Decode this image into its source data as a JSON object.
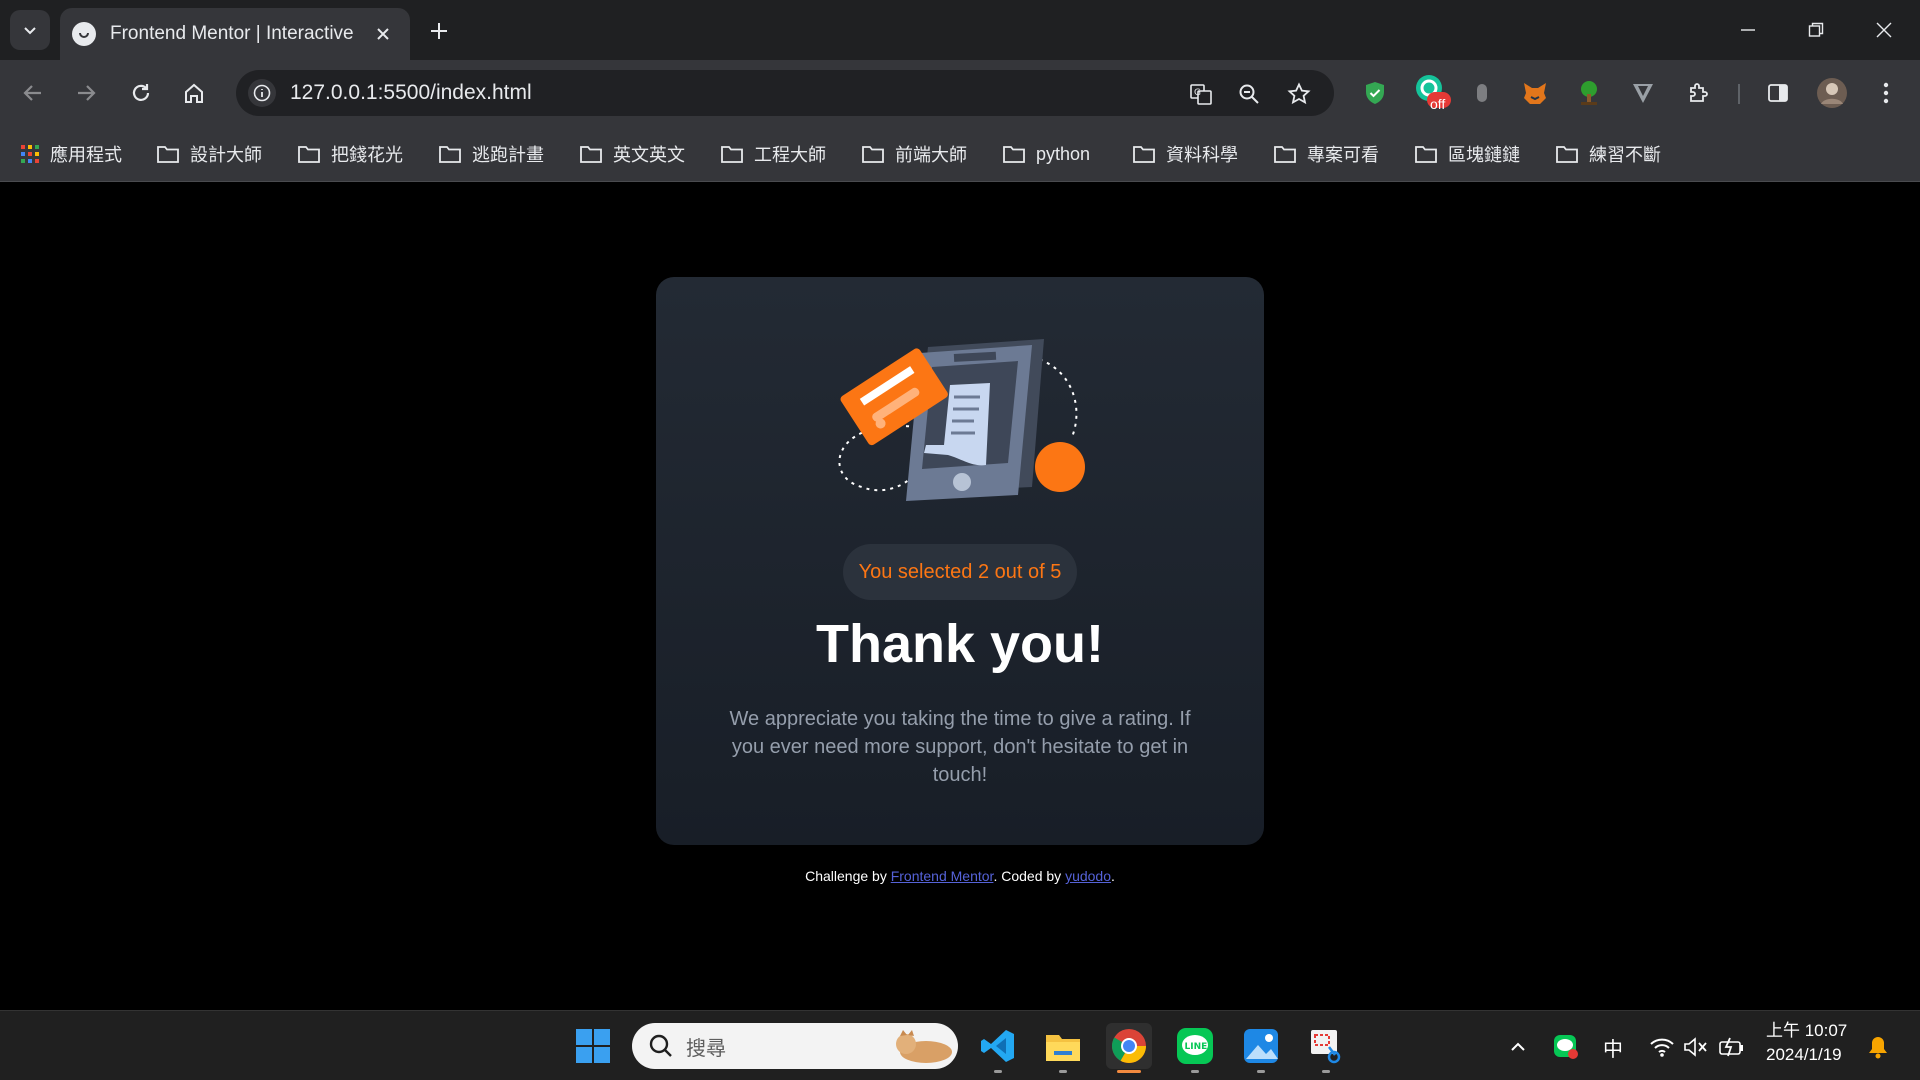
{
  "browser": {
    "tab_title": "Frontend Mentor | Interactive",
    "url": "127.0.0.1:5500/index.html",
    "extension_badge": "off"
  },
  "bookmarks": [
    {
      "label": "應用程式"
    },
    {
      "label": "設計大師"
    },
    {
      "label": "把錢花光"
    },
    {
      "label": "逃跑計畫"
    },
    {
      "label": "英文英文"
    },
    {
      "label": "工程大師"
    },
    {
      "label": "前端大師"
    },
    {
      "label": "python"
    },
    {
      "label": "資料科學"
    },
    {
      "label": "專案可看"
    },
    {
      "label": "區塊鏈鏈"
    },
    {
      "label": "練習不斷"
    }
  ],
  "card": {
    "selection": "You selected 2 out of 5",
    "heading": "Thank you!",
    "message": "We appreciate you taking the time to give a rating. If you ever need more support, don't hesitate to get in touch!"
  },
  "attribution": {
    "prefix": "Challenge by ",
    "link1": "Frontend Mentor",
    "middle": ". Coded by ",
    "link2": "yudodo",
    "suffix": "."
  },
  "taskbar": {
    "search_placeholder": "搜尋",
    "ime": "中",
    "time": "上午 10:07",
    "date": "2024/1/19"
  },
  "colors": {
    "accent": "#fc7614",
    "card_bg": "#232a34",
    "pill_bg": "#2b323c",
    "body_text": "#959eac",
    "link": "#5562d8"
  }
}
